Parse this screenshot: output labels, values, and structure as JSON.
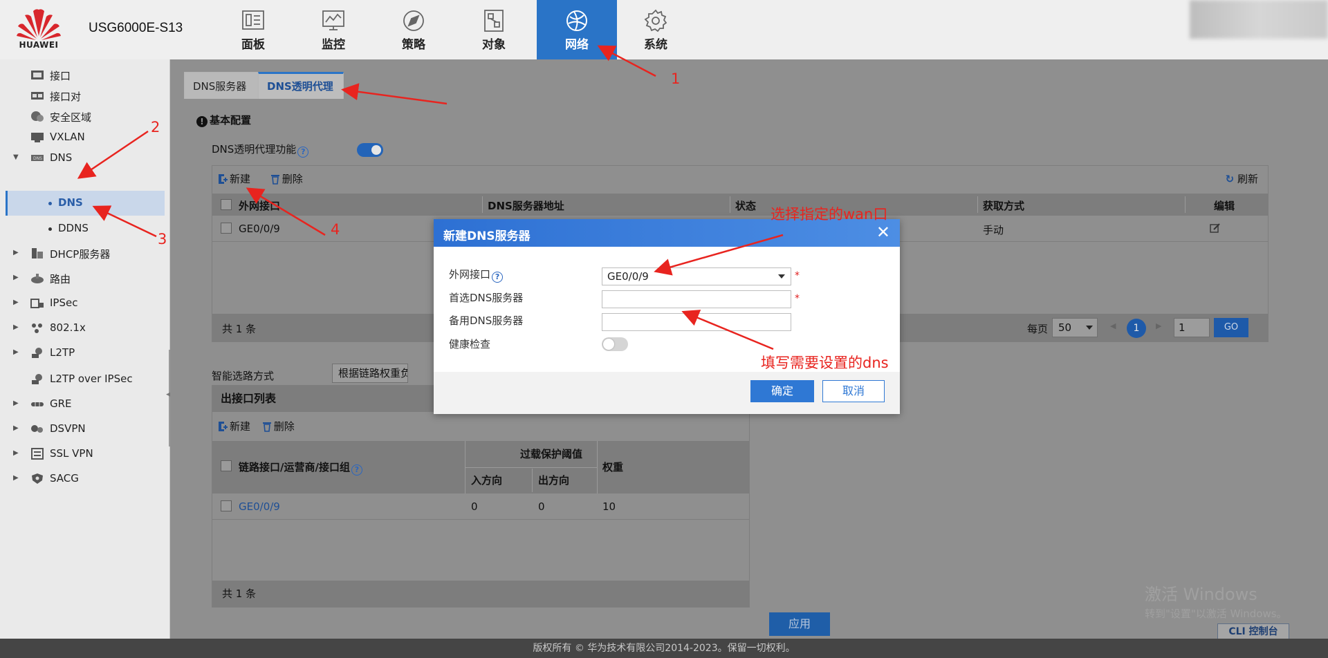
{
  "header": {
    "brand": "HUAWEI",
    "model": "USG6000E-S13",
    "nav": [
      {
        "label": "面板",
        "icon": "dashboard-icon"
      },
      {
        "label": "监控",
        "icon": "monitor-icon"
      },
      {
        "label": "策略",
        "icon": "policy-icon"
      },
      {
        "label": "对象",
        "icon": "object-icon"
      },
      {
        "label": "网络",
        "icon": "network-globe-icon",
        "active": true
      },
      {
        "label": "系统",
        "icon": "gear-icon"
      }
    ],
    "accent": "#2a74c7"
  },
  "sidebar": {
    "items": [
      {
        "label": "接口"
      },
      {
        "label": "接口对"
      },
      {
        "label": "安全区域"
      },
      {
        "label": "VXLAN"
      },
      {
        "label": "DNS",
        "expanded": true
      },
      {
        "label": "DNS",
        "sub": true,
        "selected": true
      },
      {
        "label": "DDNS",
        "sub": true
      },
      {
        "label": "DHCP服务器"
      },
      {
        "label": "路由"
      },
      {
        "label": "IPSec"
      },
      {
        "label": "802.1x"
      },
      {
        "label": "L2TP"
      },
      {
        "label": "L2TP over IPSec"
      },
      {
        "label": "GRE"
      },
      {
        "label": "DSVPN"
      },
      {
        "label": "SSL VPN"
      },
      {
        "label": "SACG"
      }
    ]
  },
  "tabs": [
    {
      "label": "DNS服务器"
    },
    {
      "label": "DNS透明代理",
      "active": true
    }
  ],
  "basic": {
    "title": "基本配置",
    "proxy_label": "DNS透明代理功能",
    "help": "?"
  },
  "grid1": {
    "new": "新建",
    "delete": "删除",
    "refresh": "刷新",
    "columns": [
      "外网接口",
      "DNS服务器地址",
      "状态",
      "获取方式",
      "编辑"
    ],
    "row": {
      "iface": "GE0/0/9",
      "method": "手动"
    },
    "total": "共 1 条",
    "per_page_label": "每页",
    "per_page": "50",
    "page": "1",
    "page_input": "1",
    "go": "GO"
  },
  "routing": {
    "label": "智能选路方式",
    "value": "根据链路权重负"
  },
  "grid2": {
    "title": "出接口列表",
    "new": "新建",
    "delete": "删除",
    "col_link": "链路接口/运营商/接口组",
    "col_threshold": "过载保护阈值",
    "col_in": "入方向",
    "col_out": "出方向",
    "col_weight": "权重",
    "row": {
      "iface": "GE0/0/9",
      "in": "0",
      "out": "0",
      "weight": "10"
    },
    "total": "共 1 条"
  },
  "apply": "应用",
  "cli": "CLI 控制台",
  "watermark": {
    "line1": "激活 Windows",
    "line2": "转到\"设置\"以激活 Windows。"
  },
  "footer": "版权所有 © 华为技术有限公司2014-2023。保留一切权利。",
  "modal": {
    "title": "新建DNS服务器",
    "close": "✕",
    "iface_label": "外网接口",
    "iface_value": "GE0/0/9",
    "primary_label": "首选DNS服务器",
    "primary_value": "",
    "backup_label": "备用DNS服务器",
    "backup_value": "",
    "health_label": "健康检查",
    "required": "*",
    "ok": "确定",
    "cancel": "取消"
  },
  "annotations": {
    "n1": "1",
    "n2": "2",
    "n3": "3",
    "n4": "4",
    "wan": "选择指定的wan口",
    "dns": "填写需要设置的dns",
    "color": "#e8241f"
  }
}
